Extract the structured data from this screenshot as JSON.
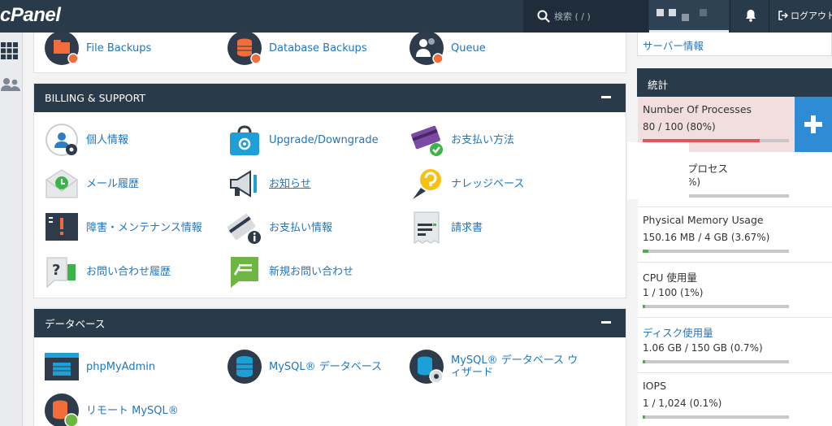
{
  "header": {
    "logo_text": "cPanel",
    "search_placeholder": "検索 ( / )",
    "logout_label": "ログアウト"
  },
  "top_panel": {
    "items": [
      {
        "label": "File Backups",
        "icon": "file-backup-icon"
      },
      {
        "label": "Database Backups",
        "icon": "database-backup-icon"
      },
      {
        "label": "Queue",
        "icon": "queue-users-icon"
      }
    ]
  },
  "billing": {
    "title": "BILLING & SUPPORT",
    "items": [
      {
        "label": "個人情報",
        "icon": "contact-info-icon"
      },
      {
        "label": "Upgrade/Downgrade",
        "icon": "upgrade-bag-icon"
      },
      {
        "label": "お支払い方法",
        "icon": "payment-card-icon"
      },
      {
        "label": "メール履歴",
        "icon": "email-history-icon"
      },
      {
        "label": "お知らせ",
        "icon": "announcement-megaphone-icon"
      },
      {
        "label": "ナレッジベース",
        "icon": "knowledge-bulb-icon"
      },
      {
        "label": "障害・メンテナンス情報",
        "icon": "maintenance-status-icon"
      },
      {
        "label": "お支払い情報",
        "icon": "billing-info-icon"
      },
      {
        "label": "請求書",
        "icon": "invoice-icon"
      },
      {
        "label": "お問い合わせ履歴",
        "icon": "support-history-icon"
      },
      {
        "label": "新規お問い合わせ",
        "icon": "new-ticket-icon"
      }
    ]
  },
  "databases": {
    "title": "データベース",
    "items": [
      {
        "label": "phpMyAdmin",
        "icon": "phpmyadmin-icon"
      },
      {
        "label": "MySQL® データベース",
        "icon": "mysql-database-icon"
      },
      {
        "label": "MySQL® データベース ウィザード",
        "icon": "mysql-wizard-icon"
      },
      {
        "label": "リモート MySQL®",
        "icon": "remote-mysql-icon"
      }
    ]
  },
  "server_info": {
    "label": "サーバー情報"
  },
  "stats": {
    "title": "統計",
    "add_icon": "plus-icon",
    "items": [
      {
        "title": "Number Of Processes",
        "value": "80 / 100   (80%)",
        "percent": 80,
        "bar_color": "#e0565a",
        "highlight": true
      },
      {
        "title": "プロセス",
        "value": "%)",
        "percent": 0,
        "bar_color": "#4cae4c",
        "highlight": false
      },
      {
        "title": "Physical Memory Usage",
        "value": "150.16 MB / 4 GB   (3.67%)",
        "percent": 3.67,
        "bar_color": "#4cae4c",
        "highlight": false
      },
      {
        "title": "CPU 使用量",
        "value": "1 / 100   (1%)",
        "percent": 1,
        "bar_color": "#4cae4c",
        "highlight": false
      },
      {
        "title": "ディスク使用量",
        "value": "1.06 GB / 150 GB   (0.7%)",
        "percent": 0.7,
        "bar_color": "#4cae4c",
        "highlight": false,
        "link": true
      },
      {
        "title": "IOPS",
        "value": "1 / 1,024   (0.1%)",
        "percent": 0.1,
        "bar_color": "#4cae4c",
        "highlight": false
      }
    ]
  }
}
